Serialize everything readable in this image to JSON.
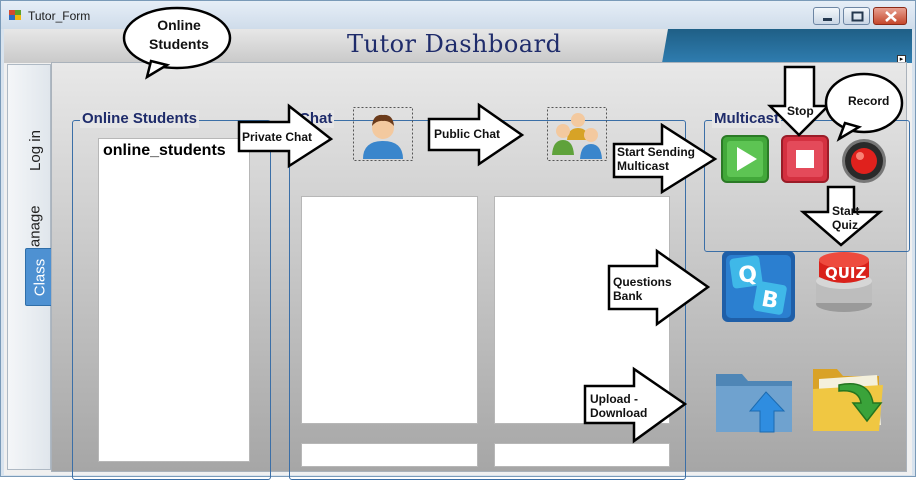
{
  "window": {
    "title": "Tutor_Form"
  },
  "header": {
    "title": "Tutor Dashboard"
  },
  "sidebar": {
    "tabs": [
      {
        "label": "Log in"
      },
      {
        "label": "Manage"
      },
      {
        "label": "Class",
        "selected": true
      }
    ]
  },
  "groups": {
    "online_students": {
      "title": "Online Students",
      "list_text": "online_students"
    },
    "chat": {
      "title": "Chat"
    },
    "multicast": {
      "title": "Multicast"
    }
  },
  "annotations": {
    "online_students": [
      "Online",
      "Students"
    ],
    "private_chat": "Private Chat",
    "public_chat": "Public Chat",
    "start_multicast": [
      "Start Sending",
      "Multicast"
    ],
    "stop": "Stop",
    "record": "Record",
    "start_quiz": [
      "Start",
      "Quiz"
    ],
    "questions_bank": [
      "Questions",
      "Bank"
    ],
    "upload_download": [
      "Upload -",
      "Download"
    ]
  },
  "icons": [
    "private-chat-icon",
    "public-chat-icon",
    "play-icon",
    "stop-icon",
    "record-icon",
    "questions-bank-icon",
    "quiz-icon",
    "upload-folder-icon",
    "download-folder-icon"
  ],
  "colors": {
    "header_title": "#1f2c6b",
    "group_title": "#1f2c6b",
    "selected_tab": "#4e91d2",
    "header_accent": "#2f7db0"
  }
}
